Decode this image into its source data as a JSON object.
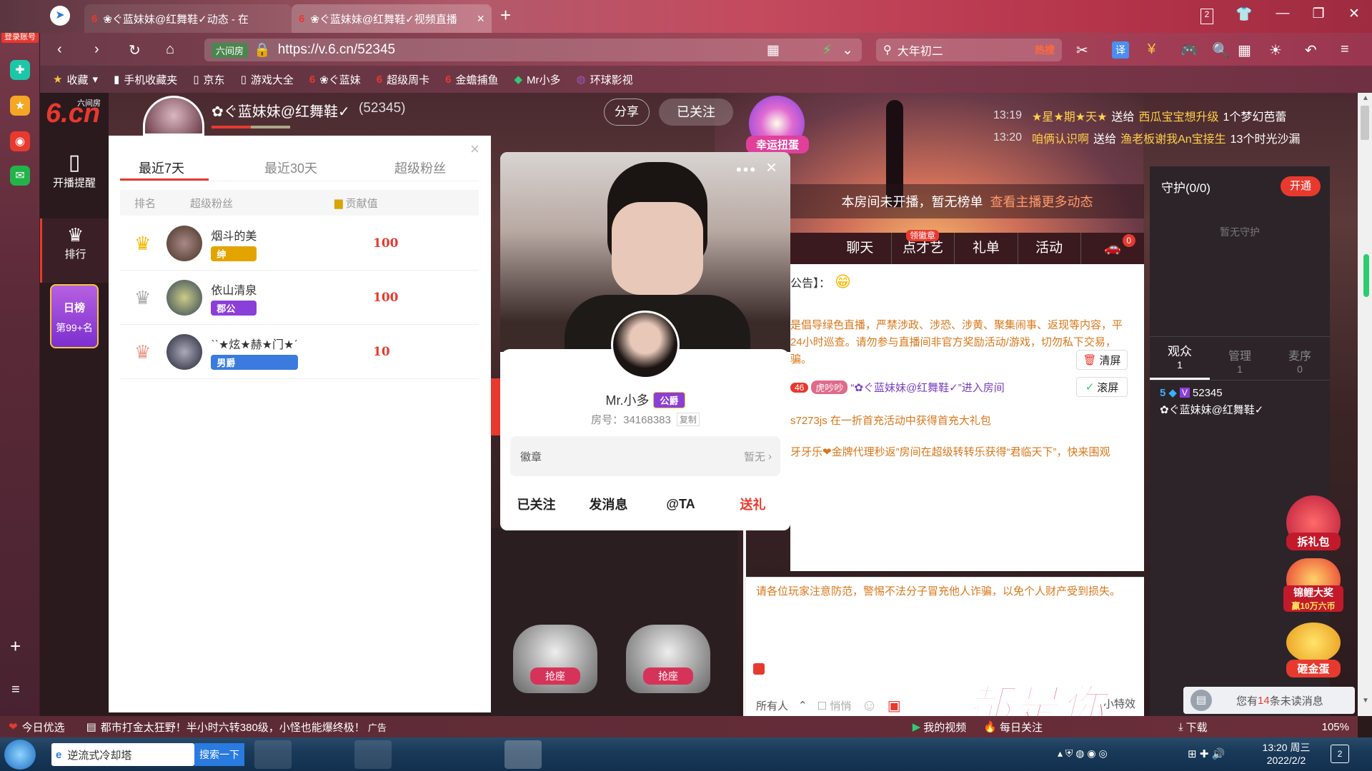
{
  "browser": {
    "login_badge": "登录账号",
    "tabs": [
      {
        "label": "❀ぐ蓝妹妹@红舞鞋✓动态 - 在"
      },
      {
        "label": "❀ぐ蓝妹妹@红舞鞋✓视频直播"
      }
    ],
    "new_tab": "+",
    "tab_count": "2",
    "url_prefix": "六间房",
    "url": "https://v.6.cn/52345",
    "search_value": "大年初二",
    "search_hot": "热搜",
    "translate": "译",
    "bookmarks": [
      "收藏",
      "手机收藏夹",
      "京东",
      "游戏大全",
      "❀ぐ蓝妹",
      "超级周卡",
      "金蟾捕鱼",
      "Mr小多",
      "环球影视"
    ]
  },
  "site": {
    "logo": "6.cn",
    "logo_sub": "六间房",
    "nav": [
      {
        "label": "开播提醒"
      },
      {
        "label": "排行"
      }
    ],
    "rank_badge_top": "日榜",
    "rank_badge_bottom": "第99+名",
    "anchor_name": "✿ぐ蓝妹妹@红舞鞋✓",
    "anchor_id": "(52345)",
    "share": "分享",
    "followed": "已关注",
    "lucky_egg": "幸运扭蛋",
    "gift_feed": [
      {
        "time": "13:19",
        "from": "★星★期★天★",
        "action": "送给",
        "to": "西瓜宝宝想升级",
        "gift": "1个梦幻芭蕾"
      },
      {
        "time": "13:20",
        "from": "咱俩认识啊",
        "action": "送给",
        "to": "渔老板谢我An宝接生",
        "gift": "13个时光沙漏"
      }
    ],
    "not_live": "本房间未开播，暂无榜单",
    "more_dynamics": "查看主播更多动态"
  },
  "fans_panel": {
    "tabs": [
      "最近7天",
      "最近30天",
      "超级粉丝"
    ],
    "headers": [
      "排名",
      "超级粉丝",
      "贡献值"
    ],
    "rows": [
      {
        "name": "烟斗的美",
        "badge": "绅",
        "value": "100",
        "color": "#e3a400"
      },
      {
        "name": "依山清泉",
        "badge": "郡公",
        "value": "100",
        "color": "#8b3fd9"
      },
      {
        "name": "`ˋ★炫★赫★门★ˊ",
        "badge": "男爵",
        "value": "10",
        "color": "#3b7be0"
      }
    ]
  },
  "user_card": {
    "name": "Mr.小多",
    "title_badge": "公爵",
    "room_label": "房号：34168383",
    "copy": "复制",
    "medal_label": "徽章",
    "medal_value": "暂无",
    "actions": [
      "已关注",
      "发消息",
      "@TA",
      "送礼"
    ]
  },
  "chat": {
    "tabs": [
      "聊天",
      "点才艺",
      "礼单",
      "活动"
    ],
    "tab_badge": "领徽章",
    "car_count": "0",
    "notice": "公告】：",
    "rules": "是倡导绿色直播，严禁涉政、涉恐、涉黄、聚集闹事、返现等内容，平24小时巡查。请勿参与直播间非官方奖励活动/游戏，切勿私下交易，骗。",
    "clear": "清屏",
    "scroll": "滚屏",
    "enter_level": "46",
    "enter_user": "虎吵吵",
    "enter_text": "“✿ぐ蓝妹妹@红舞鞋✓”进入房间",
    "msg1": "s7273js 在一折首充活动中获得首充大礼包",
    "msg2": "牙牙乐❤金牌代理秒返”房间在超级转转乐获得“君临天下”，快来围观",
    "warning": "请各位玩家注意防范，警惕不法分子冒充他人诈骗，以免个人财产受到损失。",
    "to_all": "所有人",
    "whisper": "悄悄",
    "effect": "小特效"
  },
  "seats": [
    "抢座",
    "抢座"
  ],
  "right": {
    "guard_title": "守护(0/0)",
    "open": "开通",
    "no_guard": "暂无守护",
    "audience_tabs": [
      {
        "label": "观众",
        "count": "1"
      },
      {
        "label": "管理",
        "count": "1"
      },
      {
        "label": "麦序",
        "count": "0"
      }
    ],
    "audience_level": "5",
    "audience_id": "52345",
    "audience_name": "✿ぐ蓝妹妹@红舞鞋✓",
    "gift_pack": "拆礼包",
    "koi": "锦鲤大奖",
    "koi_sub": "赢10万六币",
    "gold_egg": "砸金蛋",
    "unread_prefix": "您有",
    "unread_count": "14",
    "unread_suffix": "条未读消息",
    "overlay_text": "都是你"
  },
  "statusbar": {
    "today": "今日优选",
    "news": "都市打金太狂野！半小时六转380级，小怪也能爆终极！",
    "ad": "广告",
    "my_video": "我的视频",
    "daily": "每日关注",
    "download": "下载",
    "zoom": "105%"
  },
  "taskbar": {
    "search_placeholder": "逆流式冷却塔",
    "search_btn": "搜索一下",
    "time": "13:20 周三",
    "date": "2022/2/2",
    "notif_count": "2"
  },
  "colors": {
    "accent": "#e8392f",
    "gold": "#e3a400",
    "chat_orange": "#d9771a",
    "purple": "#8b3fd9"
  }
}
